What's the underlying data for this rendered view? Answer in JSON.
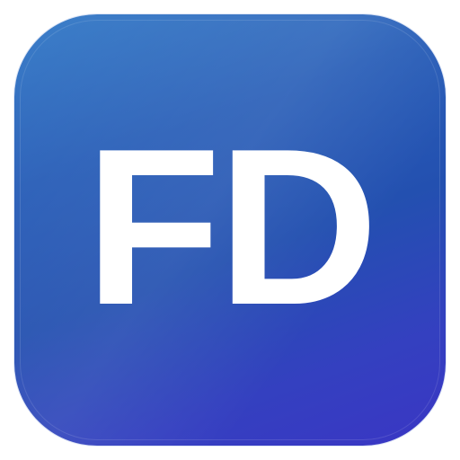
{
  "icon": {
    "monogram": "FD",
    "name": "app-icon",
    "colors": {
      "gradient_start": "#3b7fc9",
      "gradient_mid": "#2350b0",
      "gradient_end": "#3a36c4",
      "text": "#ffffff",
      "background": "#ffffff"
    }
  }
}
